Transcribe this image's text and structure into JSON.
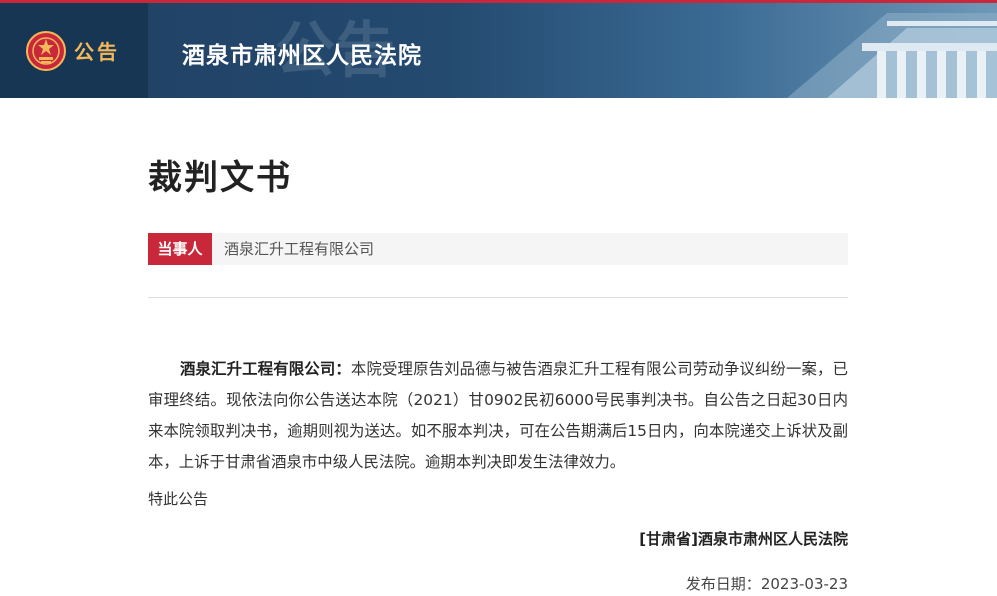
{
  "header": {
    "notice_label": "公告",
    "court_name": "酒泉市肃州区人民法院",
    "watermark_text": "公告"
  },
  "document": {
    "title": "裁判文书",
    "party_label": "当事人",
    "party_value": "酒泉汇升工程有限公司",
    "addressee": "酒泉汇升工程有限公司：",
    "body": "本院受理原告刘品德与被告酒泉汇升工程有限公司劳动争议纠纷一案，已审理终结。现依法向你公告送达本院（2021）甘0902民初6000号民事判决书。自公告之日起30日内来本院领取判决书，逾期则视为送达。如不服本判决，可在公告期满后15日内，向本院递交上诉状及副本，上诉于甘肃省酒泉市中级人民法院。逾期本判决即发生法律效力。",
    "closing": "特此公告",
    "signature": "[甘肃省]酒泉市肃州区人民法院",
    "date_label": "发布日期：",
    "date_value": "2023-03-23"
  },
  "colors": {
    "accent_red": "#c8283a",
    "header_blue": "#1f3f61",
    "emblem_gold": "#f4b85a"
  }
}
